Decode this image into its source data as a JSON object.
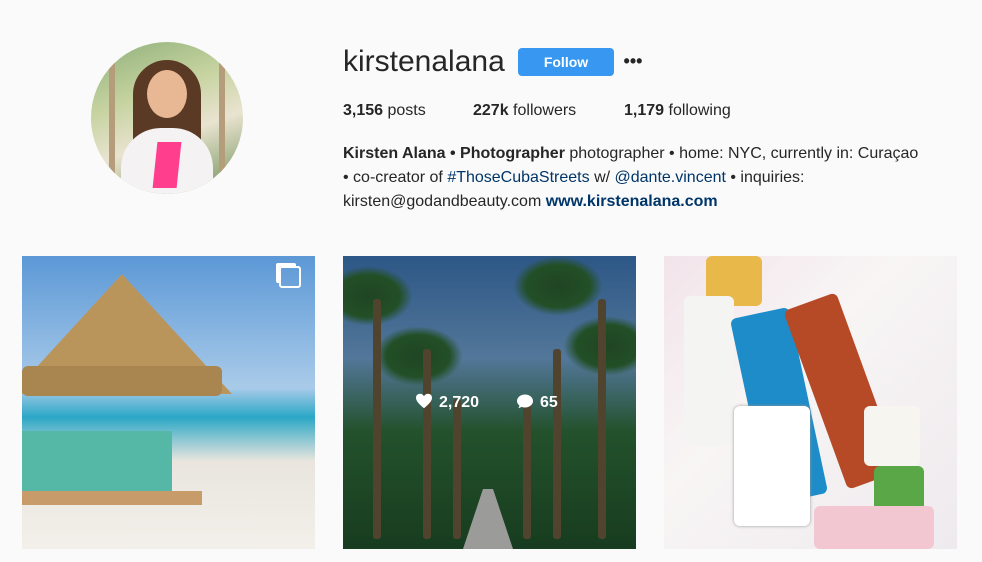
{
  "profile": {
    "username": "kirstenalana",
    "follow_label": "Follow",
    "more_label": "•••",
    "stats": {
      "posts_count": "3,156",
      "posts_label": "posts",
      "followers_count": "227k",
      "followers_label": "followers",
      "following_count": "1,179",
      "following_label": "following"
    },
    "bio": {
      "name": "Kirsten Alana • Photographer",
      "line1_rest": " photographer • home: NYC, currently in: Curaçao",
      "line2_pre": "• co-creator of ",
      "hashtag": "#ThoseCubaStreets",
      "line2_mid": " w/ ",
      "mention": "@dante.vincent",
      "line2_post": " • inquiries:",
      "email": "kirsten@godandbeauty.com",
      "website": "www.kirstenalana.com"
    }
  },
  "posts": [
    {
      "description_icon": "multiple-photos-icon"
    },
    {
      "likes": "2,720",
      "comments": "65"
    },
    {}
  ],
  "colors": {
    "follow_button": "#3897f0",
    "link": "#003569",
    "background": "#fafafa"
  }
}
